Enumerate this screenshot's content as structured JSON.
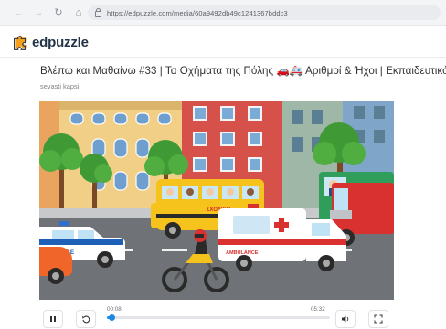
{
  "browser": {
    "back_icon": "arrow-left",
    "forward_icon": "arrow-right",
    "reload_icon": "reload",
    "home_icon": "home",
    "url": "https://edpuzzle.com/media/60a9492db49c1241367bddc3"
  },
  "app": {
    "name": "edpuzzle",
    "brand_color": "#f6a01a"
  },
  "video": {
    "title": "Βλέπω και Μαθαίνω #33 | Τα Οχήματα της Πόλης 🚗🚑 Αριθμοί & Ήχοι | Εκπαιδευτικό",
    "author": "sevasti kapsi",
    "scene_bus_sign": "ΣΧΟΛΙΚΟ",
    "scene_ambulance_sign": "AMBULANCE",
    "scene_police_sign": "POLICE"
  },
  "player": {
    "current_time": "00:08",
    "duration": "05:32",
    "progress": 0.024,
    "play_state": "pause-icon",
    "accent": "#1e88e5"
  }
}
